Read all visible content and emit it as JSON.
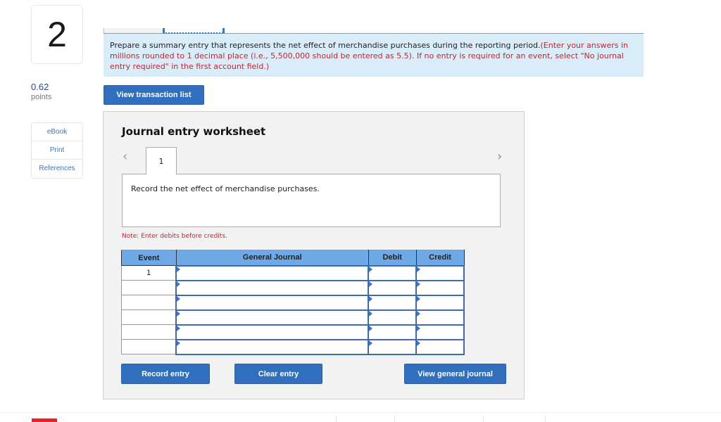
{
  "question": {
    "number": "2",
    "points_value": "0.62",
    "points_label": "points"
  },
  "side_links": [
    {
      "label": "eBook"
    },
    {
      "label": "Print"
    },
    {
      "label": "References"
    }
  ],
  "instruction": {
    "text": "Prepare a summary entry that represents the net effect of merchandise purchases during the reporting period.",
    "note_red": "(Enter your answers in millions rounded to 1 decimal place (i.e., 5,500,000 should be entered as 5.5). If no entry is required for an event, select \"No journal entry required\" in the first account field.)"
  },
  "buttons": {
    "view_transaction_list": "View transaction list",
    "record_entry": "Record entry",
    "clear_entry": "Clear entry",
    "view_general_journal": "View general journal"
  },
  "worksheet": {
    "title": "Journal entry worksheet",
    "prev_icon": "‹",
    "next_icon": "›",
    "tabs": [
      "1"
    ],
    "description": "Record the net effect of merchandise purchases.",
    "note": "Note: Enter debits before credits.",
    "table": {
      "headers": [
        "Event",
        "General Journal",
        "Debit",
        "Credit"
      ],
      "rows": [
        {
          "event": "1",
          "account": "",
          "debit": "",
          "credit": ""
        },
        {
          "event": "",
          "account": "",
          "debit": "",
          "credit": ""
        },
        {
          "event": "",
          "account": "",
          "debit": "",
          "credit": ""
        },
        {
          "event": "",
          "account": "",
          "debit": "",
          "credit": ""
        },
        {
          "event": "",
          "account": "",
          "debit": "",
          "credit": ""
        },
        {
          "event": "",
          "account": "",
          "debit": "",
          "credit": ""
        }
      ]
    }
  },
  "colors": {
    "accent_button": "#2f6fbd",
    "instruction_bg": "#d9ecfa",
    "warning_red": "#c0252d",
    "table_header": "#6fa8e6"
  }
}
